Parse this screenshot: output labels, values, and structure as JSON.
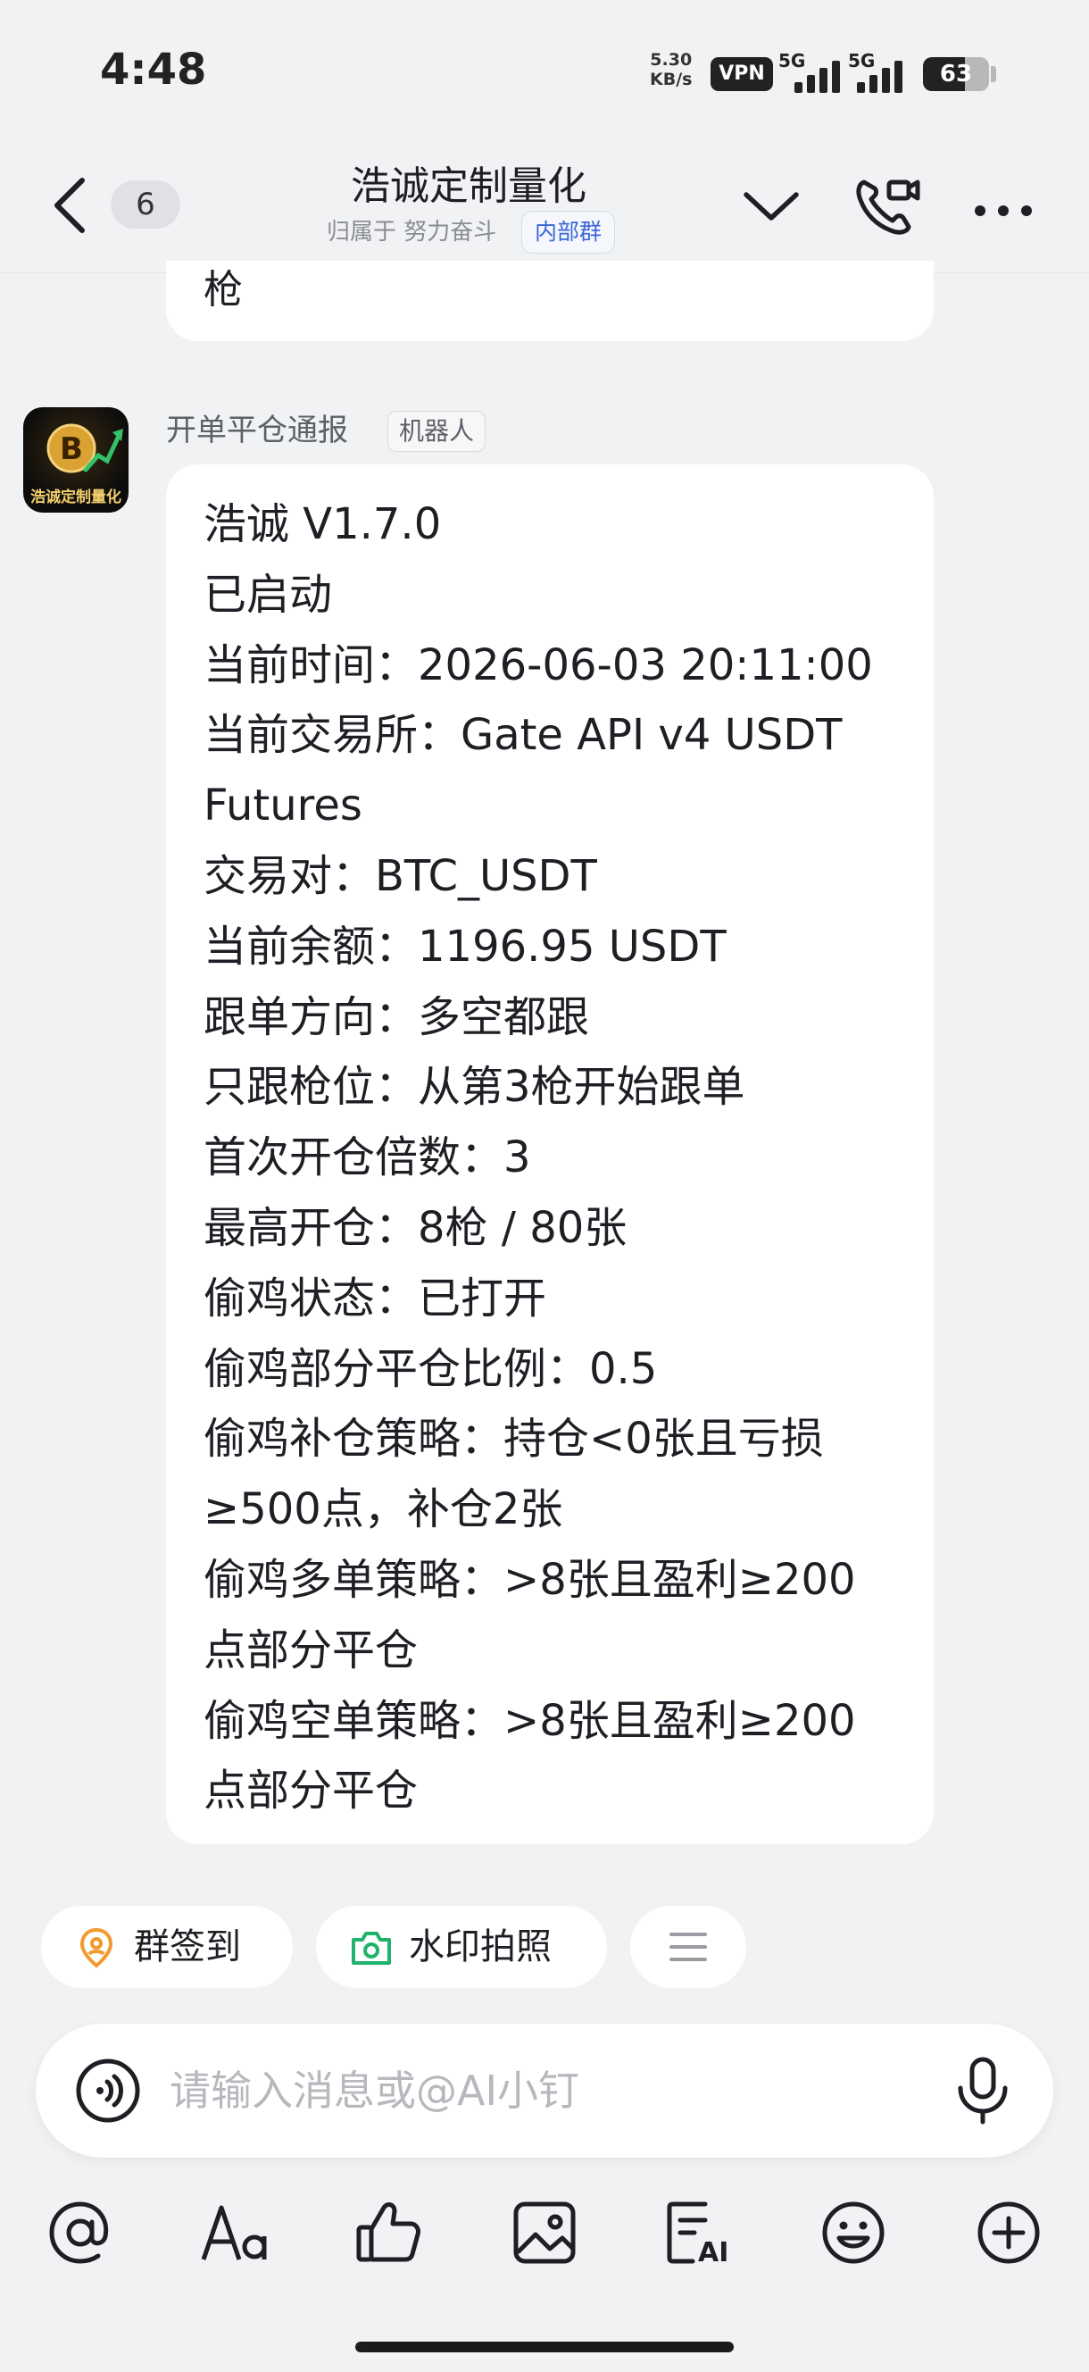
{
  "status_bar": {
    "time": "4:48",
    "net_speed_value": "5.30",
    "net_speed_unit": "KB/s",
    "vpn": "VPN",
    "signal_label_1": "5G",
    "signal_label_2": "5G",
    "battery": "63",
    "battery_level": 0.63
  },
  "header": {
    "unread_count": "6",
    "title": "浩诚定制量化",
    "subtitle": "归属于 努力奋斗",
    "tag": "内部群"
  },
  "previous_message": {
    "tail_text": "枪"
  },
  "message": {
    "sender": "开单平仓通报",
    "sender_tag": "机器人",
    "avatar_text": "浩诚定制量化",
    "lines": [
      "浩诚 V1.7.0",
      "已启动",
      "当前时间：2026-06-03 20:11:00",
      "当前交易所：Gate API v4 USDT",
      "Futures",
      "交易对：BTC_USDT",
      "当前余额：1196.95 USDT",
      "跟单方向：多空都跟",
      "只跟枪位：从第3枪开始跟单",
      "首次开仓倍数：3",
      "最高开仓：8枪 / 80张",
      "偷鸡状态：已打开",
      "偷鸡部分平仓比例：0.5",
      "偷鸡补仓策略：持仓<0张且亏损",
      "≥500点，补仓2张",
      "偷鸡多单策略：>8张且盈利≥200",
      "点部分平仓",
      "偷鸡空单策略：>8张且盈利≥200",
      "点部分平仓"
    ]
  },
  "quick_actions": {
    "checkin": "群签到",
    "watermark_photo": "水印拍照"
  },
  "input": {
    "placeholder": "请输入消息或@AI小钉"
  },
  "colors": {
    "background": "#f1f2f4",
    "bubble": "#ffffff",
    "tag_blue": "#3a66d6",
    "checkin_orange": "#f29a2e",
    "camera_green": "#1fb36b"
  }
}
